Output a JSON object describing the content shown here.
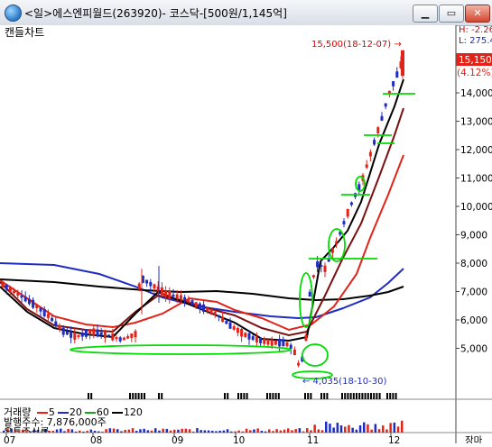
{
  "window": {
    "title": "<일>에스엔피월드(263920)- 코스닥-[500원/1,145억]",
    "minimize": "▁",
    "restore": "▭",
    "close": "✕"
  },
  "chart": {
    "tab_label": "캔들차트",
    "high_note": "15,500(18-12-07) →",
    "low_note": "← 4,035(18-10-30)",
    "top_right_h": "H: -2.26",
    "top_right_l": "L: 275.4",
    "current_price": "15,150",
    "current_pct": "(4.12%)",
    "y_ticks": [
      "14,000",
      "13,000",
      "12,000",
      "11,000",
      "10,000",
      "9,000",
      "8,000",
      "7,000",
      "6,000",
      "5,000"
    ],
    "x_ticks": [
      "07",
      "08",
      "09",
      "10",
      "11",
      "12"
    ],
    "x_right_label": "장마",
    "colors": {
      "up": "#e2231a",
      "down": "#1f2cc2",
      "ma5": "#e2231a",
      "ma20": "#1f2cc2",
      "ma60": "#1aa31a",
      "ma120": "#000000",
      "highlight": "#00dd00"
    }
  },
  "volume": {
    "legend_prefix": "거래량",
    "ma_items": [
      {
        "label": "5",
        "color": "#e2231a"
      },
      {
        "label": "20",
        "color": "#1f2cc2"
      },
      {
        "label": "60",
        "color": "#1aa31a"
      },
      {
        "label": "120",
        "color": "#000000"
      }
    ],
    "shares_label": "발행주수: 7,876,000주",
    "float_label": "유통주식률"
  }
}
